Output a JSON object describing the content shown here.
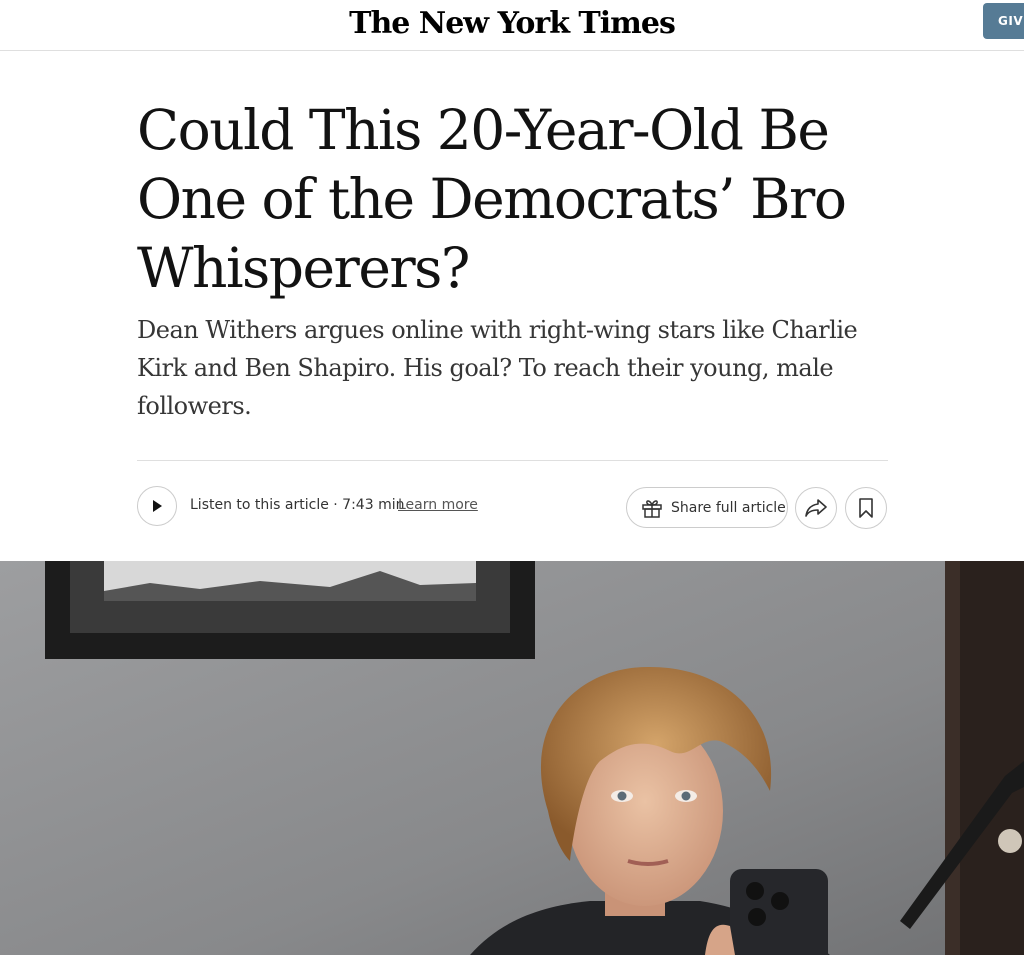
{
  "masthead": {
    "logo_text": "The New York Times",
    "give_button_label": "GIVE"
  },
  "article": {
    "headline": "Could This 20-Year-Old Be One of the Democrats’ Bro Whisperers?",
    "summary": "Dean Withers argues online with right-wing stars like Charlie Kirk and Ben Shapiro. His goal? To reach their young, male followers."
  },
  "toolbar": {
    "listen_label": "Listen to this article · 7:43 min",
    "learn_more_label": "Learn more",
    "share_full_label": "Share full article",
    "icons": {
      "play": "play-icon",
      "gift": "gift-icon",
      "share": "share-icon",
      "bookmark": "bookmark-icon"
    }
  },
  "colors": {
    "give_button": "#567b95",
    "text": "#121212",
    "rule": "#dfdfdf"
  }
}
